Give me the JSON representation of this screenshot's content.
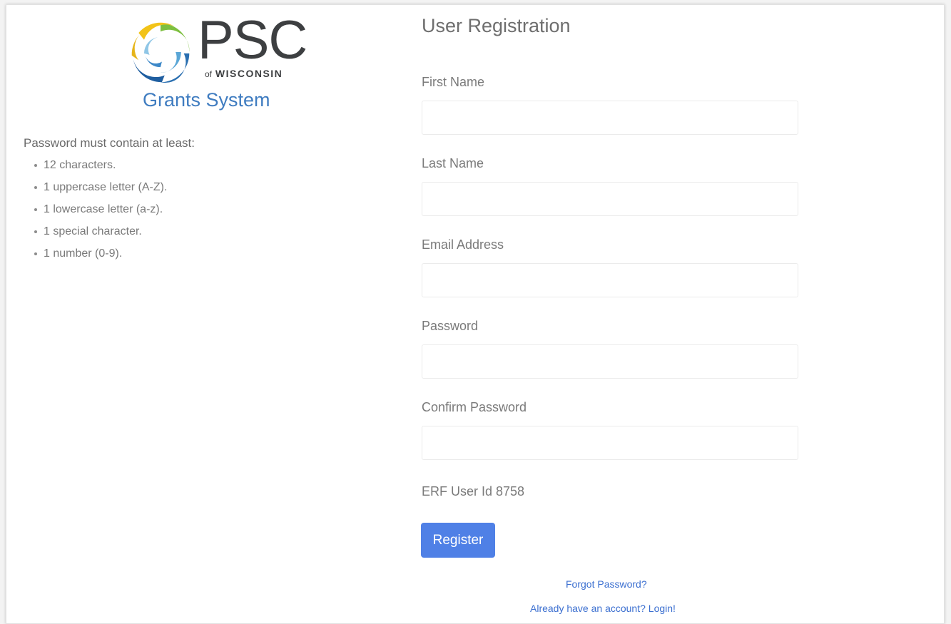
{
  "logo": {
    "icon": "psc-swirl-logo-icon",
    "wordmark": "PSC",
    "subtitle_of": "of",
    "subtitle_state": "WISCONSIN"
  },
  "app_name": "Grants System",
  "password_rules": {
    "title": "Password must contain at least:",
    "items": [
      "12 characters.",
      "1 uppercase letter (A-Z).",
      "1 lowercase letter (a-z).",
      "1 special character.",
      "1 number (0-9)."
    ]
  },
  "form": {
    "title": "User Registration",
    "fields": [
      {
        "label": "First Name",
        "value": "",
        "placeholder": ""
      },
      {
        "label": "Last Name",
        "value": "",
        "placeholder": ""
      },
      {
        "label": "Email Address",
        "value": "",
        "placeholder": ""
      },
      {
        "label": "Password",
        "value": "",
        "placeholder": ""
      },
      {
        "label": "Confirm Password",
        "value": "",
        "placeholder": ""
      }
    ],
    "user_id_text": "ERF User Id 8758",
    "register_label": "Register"
  },
  "links": {
    "forgot_password": "Forgot Password?",
    "login": "Already have an account? Login!"
  },
  "colors": {
    "accent": "#4f80e6",
    "app_name": "#3f7cc0",
    "link": "#3b6fd0"
  }
}
